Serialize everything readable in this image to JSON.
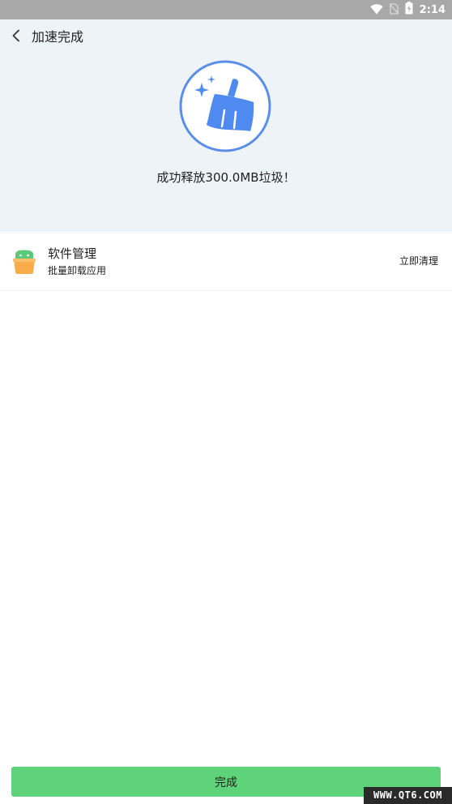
{
  "status_bar": {
    "time": "2:14",
    "icons": [
      "wifi-icon",
      "no-sim-icon",
      "battery-charging-icon"
    ]
  },
  "header": {
    "title": "加速完成",
    "back_icon": "chevron-left-icon"
  },
  "hero": {
    "icon": "broom-sparkle-icon",
    "result_text": "成功释放300.0MB垃圾！",
    "accent_color": "#4f8af0",
    "background_color": "#eef3f8"
  },
  "recommendation": {
    "icon": "android-app-icon",
    "title": "软件管理",
    "subtitle": "批量卸载应用",
    "action_label": "立即清理"
  },
  "footer": {
    "done_label": "完成",
    "button_color": "#5fd37a"
  },
  "watermark": {
    "text": "WWW.QT6.COM"
  }
}
